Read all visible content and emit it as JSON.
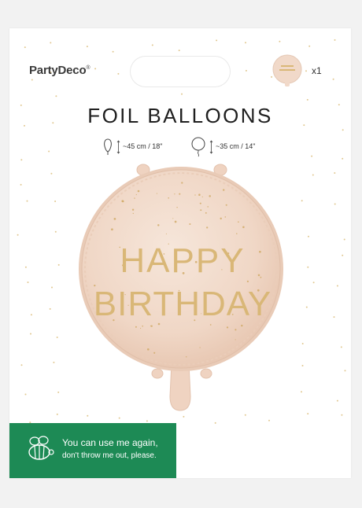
{
  "brand": {
    "name": "PartyDeco",
    "mark": "®"
  },
  "package": {
    "quantity": "x1"
  },
  "product": {
    "title": "FOIL BALLOONS"
  },
  "sizes": [
    {
      "icon": "uninflated-balloon-icon",
      "value": "~45 cm / 18\""
    },
    {
      "icon": "inflated-balloon-icon",
      "value": "~35 cm / 14\""
    }
  ],
  "balloon": {
    "line1": "HAPPY",
    "line2": "BIRTHDAY",
    "colors": {
      "body": "#f1d9c9",
      "gold": "#d9b777"
    }
  },
  "eco_badge": {
    "icon": "bee-icon",
    "line1": "You can use me again,",
    "line2": "don't throw me out, please.",
    "color": "#1d8a55"
  }
}
